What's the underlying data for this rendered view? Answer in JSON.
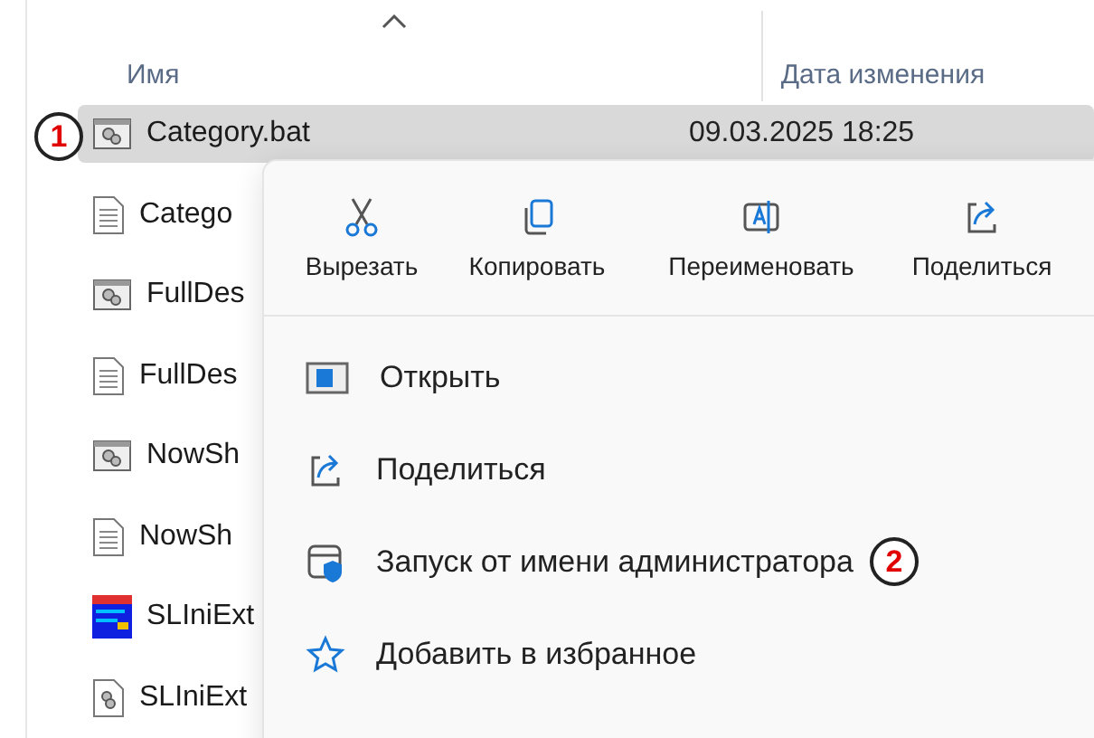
{
  "columns": [
    {
      "label": "Имя",
      "sorted": true
    },
    {
      "label": "Дата изменения",
      "sorted": false
    }
  ],
  "files": [
    {
      "name": "Category.bat",
      "kind": "batch",
      "selected": true,
      "date": "09.03.2025 18:25",
      "marker": "1"
    },
    {
      "name": "Catego",
      "kind": "text",
      "selected": false
    },
    {
      "name": "FullDes",
      "kind": "batch",
      "selected": false
    },
    {
      "name": "FullDes",
      "kind": "text",
      "selected": false
    },
    {
      "name": "NowSh",
      "kind": "batch",
      "selected": false
    },
    {
      "name": "NowSh",
      "kind": "text",
      "selected": false
    },
    {
      "name": "SLIniExt",
      "kind": "app",
      "selected": false
    },
    {
      "name": "SLIniExt",
      "kind": "config",
      "selected": false
    }
  ],
  "context_menu": {
    "toolbar": [
      {
        "label": "Вырезать",
        "kind": "cut"
      },
      {
        "label": "Копировать",
        "kind": "copy"
      },
      {
        "label": "Переименовать",
        "kind": "rename"
      },
      {
        "label": "Поделиться",
        "kind": "share"
      }
    ],
    "items": [
      {
        "label": "Открыть",
        "kind": "open"
      },
      {
        "label": "Поделиться",
        "kind": "share"
      },
      {
        "label": "Запуск от имени администратора",
        "kind": "admin",
        "marker": "2"
      },
      {
        "label": "Добавить в избранное",
        "kind": "favorite"
      }
    ]
  }
}
